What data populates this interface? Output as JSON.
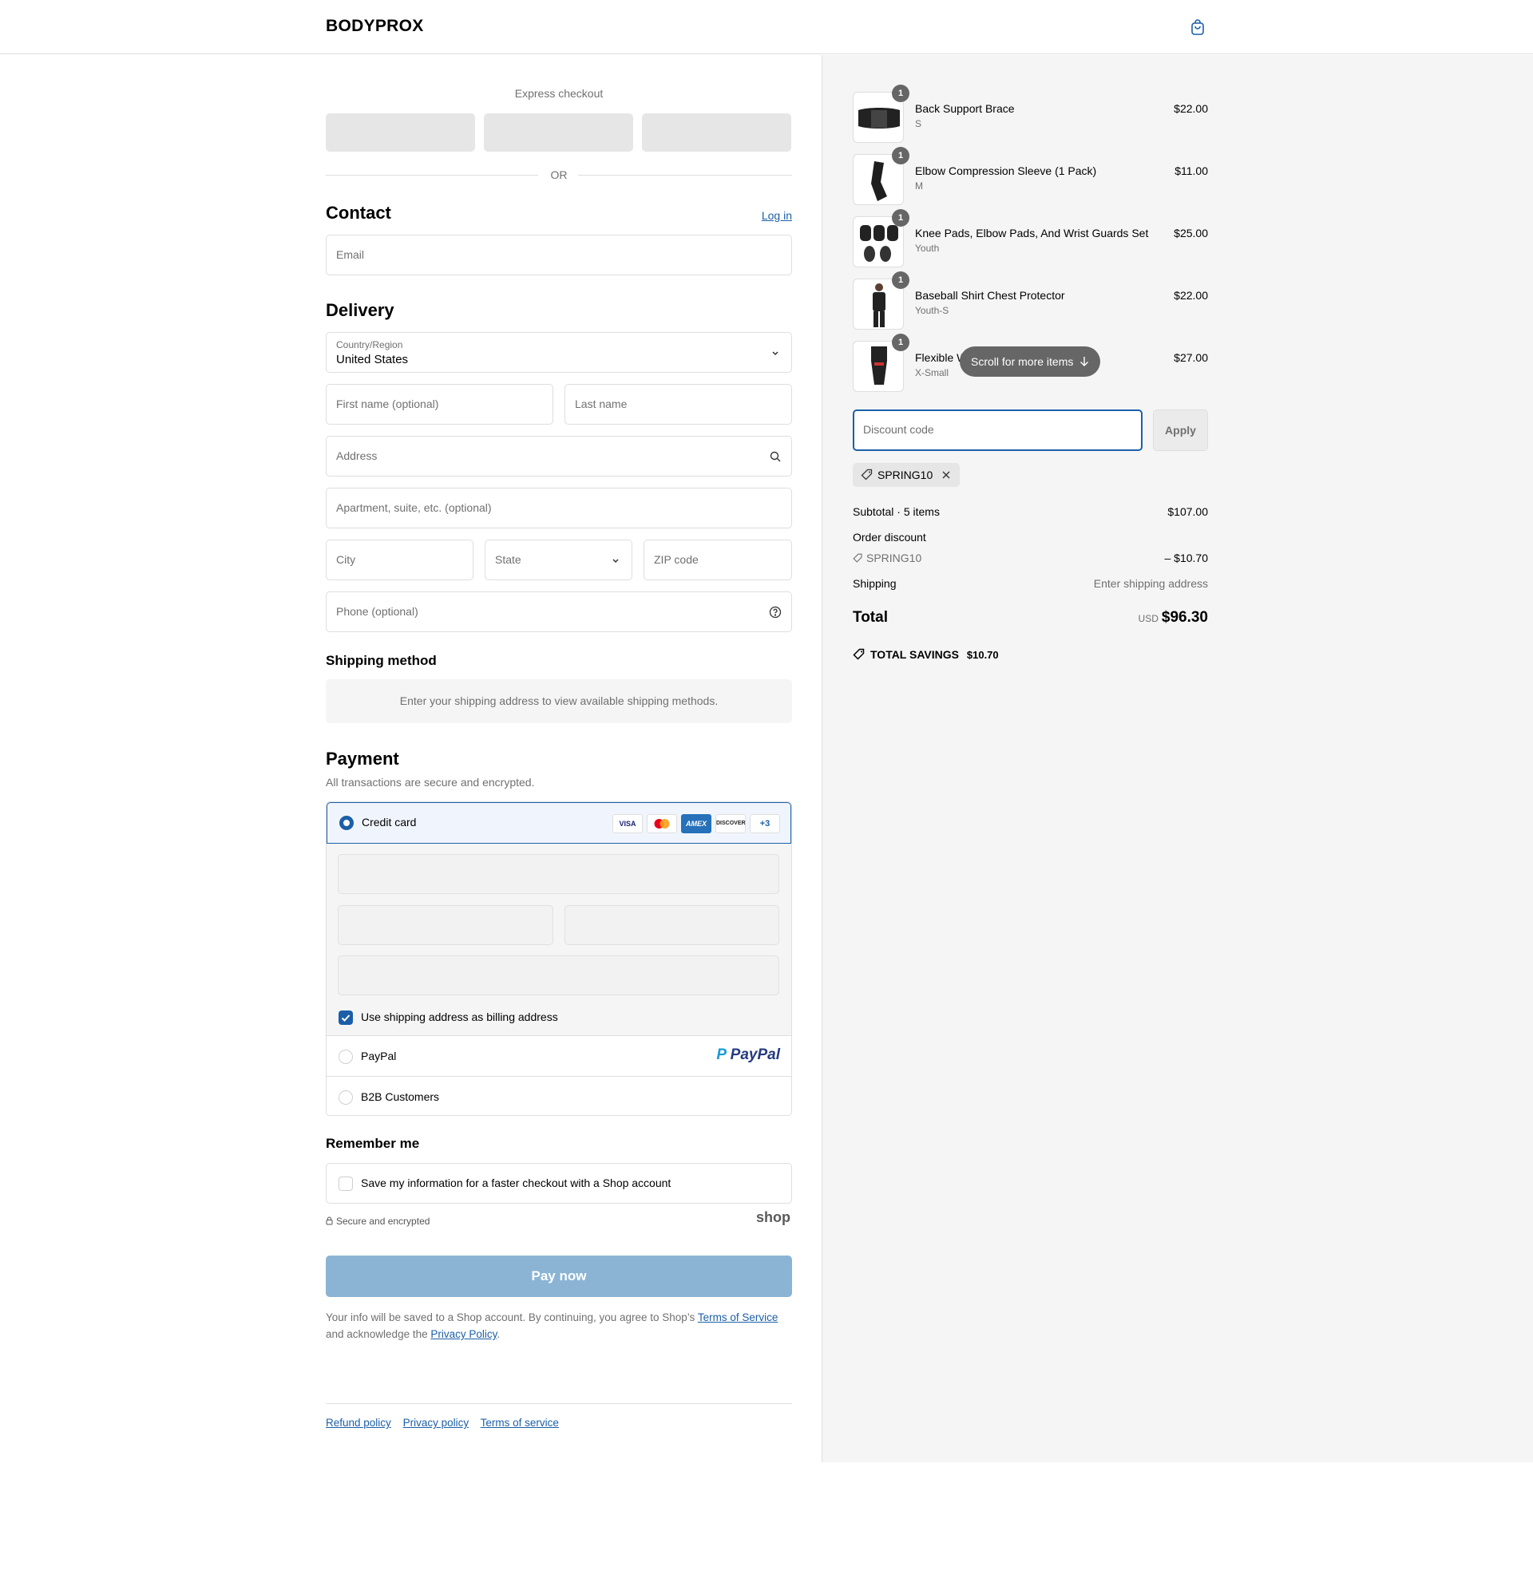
{
  "header": {
    "brand": "BODYPROX",
    "cart_icon": "bag-icon"
  },
  "express": {
    "title": "Express checkout",
    "or_label": "OR"
  },
  "contact": {
    "title": "Contact",
    "login_link": "Log in",
    "email_placeholder": "Email"
  },
  "delivery": {
    "title": "Delivery",
    "country_label": "Country/Region",
    "country_value": "United States",
    "first_name_placeholder": "First name (optional)",
    "last_name_placeholder": "Last name",
    "address_placeholder": "Address",
    "apartment_placeholder": "Apartment, suite, etc. (optional)",
    "city_placeholder": "City",
    "state_placeholder": "State",
    "zip_placeholder": "ZIP code",
    "phone_placeholder": "Phone (optional)"
  },
  "shipping_method": {
    "title": "Shipping method",
    "notice": "Enter your shipping address to view available shipping methods."
  },
  "payment": {
    "title": "Payment",
    "subtitle": "All transactions are secure and encrypted.",
    "credit_card_label": "Credit card",
    "card_brands": [
      "VISA",
      "mastercard",
      "AMEX",
      "DISCOVER"
    ],
    "more_brands": "+3",
    "billing_checkbox_label": "Use shipping address as billing address",
    "paypal_label": "PayPal",
    "paypal_logo": "PayPal",
    "b2b_label": "B2B Customers"
  },
  "remember": {
    "title": "Remember me",
    "checkbox_label": "Save my information for a faster checkout with a Shop account",
    "secure_text": "Secure and encrypted",
    "shop_logo": "shop"
  },
  "pay_now_label": "Pay now",
  "legal": {
    "prefix": "Your info will be saved to a Shop account. By continuing, you agree to Shop’s ",
    "terms_link": "Terms of Service",
    "middle": "and acknowledge the ",
    "privacy_link": "Privacy Policy",
    "suffix": "."
  },
  "footer": {
    "refund": "Refund policy",
    "privacy": "Privacy policy",
    "terms": "Terms of service"
  },
  "cart": {
    "items": [
      {
        "name": "Back Support Brace",
        "variant": "S",
        "price": "$22.00",
        "qty": "1"
      },
      {
        "name": "Elbow Compression Sleeve (1 Pack)",
        "variant": "M",
        "price": "$11.00",
        "qty": "1"
      },
      {
        "name": "Knee Pads, Elbow Pads, And Wrist Guards Set",
        "variant": "Youth",
        "price": "$25.00",
        "qty": "1"
      },
      {
        "name": "Baseball Shirt Chest Protector",
        "variant": "Youth-S",
        "price": "$22.00",
        "qty": "1"
      },
      {
        "name": "Flexible W",
        "variant": "X-Small",
        "price": "$27.00",
        "qty": "1"
      }
    ],
    "scroll_hint": "Scroll for more items",
    "discount_placeholder": "Discount code",
    "apply_label": "Apply",
    "applied_code": "SPRING10",
    "subtotal_label": "Subtotal · 5 items",
    "subtotal_value": "$107.00",
    "order_discount_label": "Order discount",
    "discount_code_label": "SPRING10",
    "discount_value": "– $10.70",
    "shipping_label": "Shipping",
    "shipping_value": "Enter shipping address",
    "total_label": "Total",
    "currency": "USD",
    "total_value": "$96.30",
    "savings_label": "TOTAL SAVINGS",
    "savings_value": "$10.70"
  },
  "colors": {
    "accent": "#1c5fa8",
    "pay_button": "#8bb4d4",
    "summary_bg": "#f5f5f5"
  }
}
